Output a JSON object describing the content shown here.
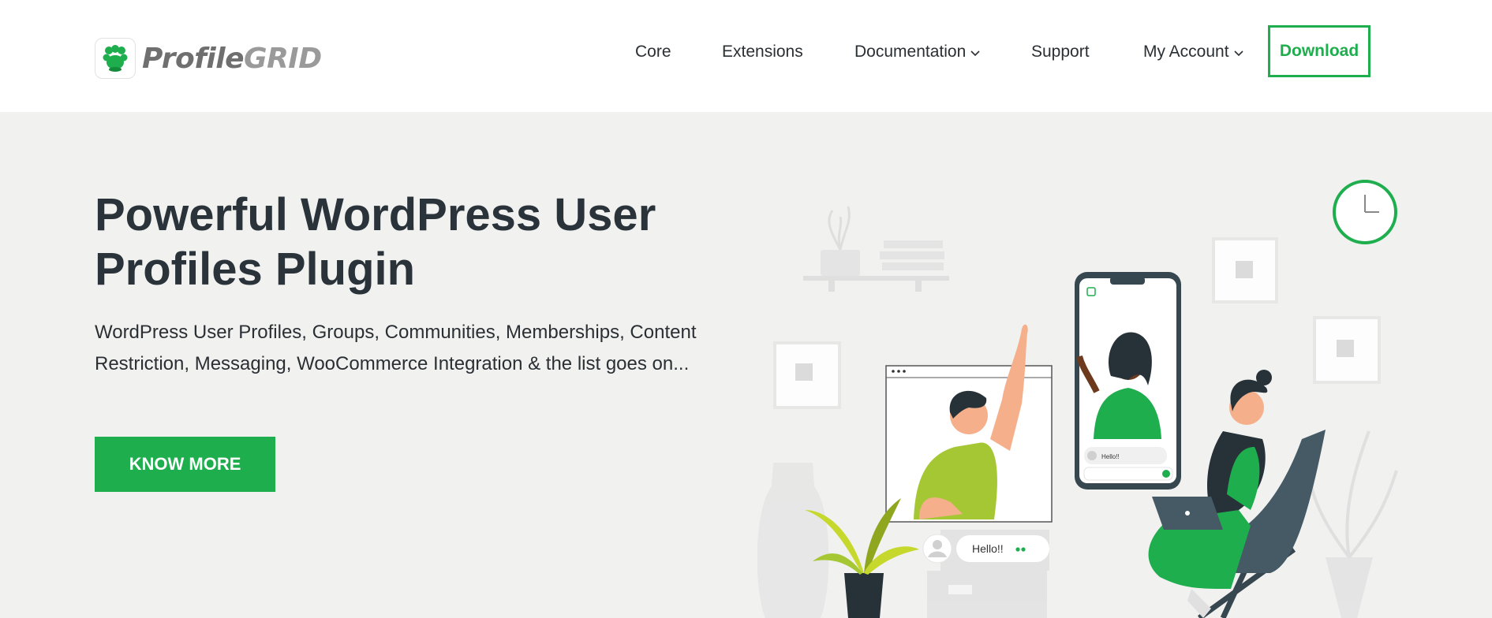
{
  "brand": {
    "name_part1": "Profile",
    "name_part2": "GRID"
  },
  "nav": {
    "items": [
      {
        "label": "Core"
      },
      {
        "label": "Extensions"
      },
      {
        "label": "Documentation",
        "has_dropdown": true
      },
      {
        "label": "Support"
      },
      {
        "label": "My Account",
        "has_dropdown": true
      }
    ],
    "download_label": "Download"
  },
  "hero": {
    "title": "Powerful WordPress User Profiles Plugin",
    "description": "WordPress User Profiles, Groups, Communities, Memberships, Content Restriction, Messaging, WooCommerce Integration & the list goes on...",
    "cta_label": "KNOW MORE"
  },
  "illustration": {
    "chat_bubble_text": "Hello!!",
    "phone_bubble_text": "Hello!!"
  },
  "colors": {
    "accent": "#1eae4e",
    "hero_bg": "#f1f1f0",
    "text_dark": "#2a333a"
  }
}
